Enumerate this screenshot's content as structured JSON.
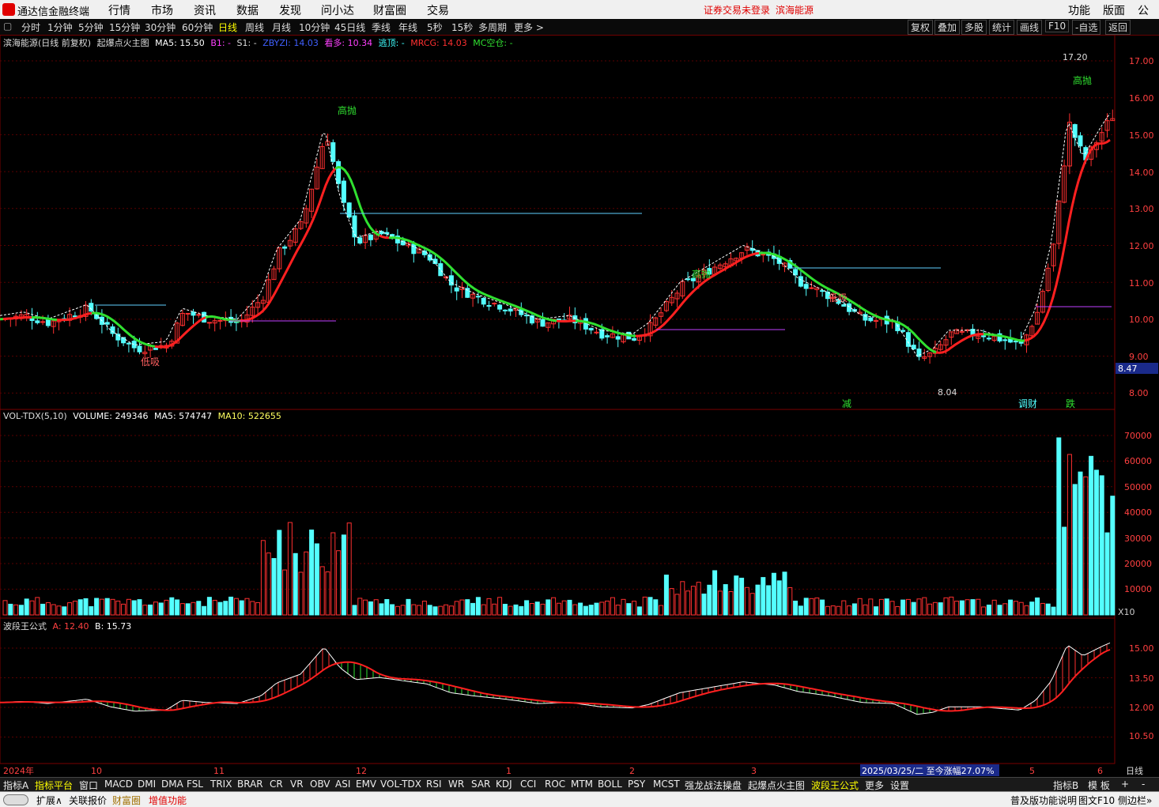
{
  "app": {
    "title": "通达信金融终端",
    "menu": [
      "行情",
      "市场",
      "资讯",
      "数据",
      "发现",
      "问小达",
      "财富圈",
      "交易"
    ],
    "status_login": "证券交易未登录",
    "status_stock": "滨海能源",
    "right_menu": [
      "功能",
      "版面",
      "公式"
    ]
  },
  "periods": {
    "items": [
      "分时",
      "1分钟",
      "5分钟",
      "15分钟",
      "30分钟",
      "60分钟",
      "日线",
      "周线",
      "月线",
      "10分钟",
      "45日线",
      "季线",
      "年线",
      "5秒",
      "15秒",
      "多周期",
      "更多 >"
    ],
    "active": "日线",
    "right_buttons": [
      "复权",
      "叠加",
      "多股",
      "统计",
      "画线",
      "F10",
      "-自选",
      "返回"
    ]
  },
  "main_panel": {
    "title": "滨海能源(日线 前复权)",
    "indicator": "起爆点火主图",
    "ma5": "MA5: 15.50",
    "b1": "B1: -",
    "s1": "S1: -",
    "zbyzi": "ZBYZI: 14.03",
    "kanduo": "看多: 10.34",
    "taoding": "逃顶: -",
    "mrcg": "MRCG: 14.03",
    "mckongcang": "MC空仓: -",
    "y_ticks": [
      "17.00",
      "16.00",
      "15.00",
      "14.00",
      "13.00",
      "12.00",
      "11.00",
      "10.00",
      "9.00",
      "8.00"
    ],
    "price_tag": "8.47",
    "high_label": "17.20",
    "low_label": "8.04",
    "annotations": {
      "gaopao": "高抛",
      "dixi": "低吸",
      "jian": "减",
      "tongcai": "调财",
      "die": "跌"
    }
  },
  "volume_panel": {
    "title": "VOL-TDX(5,10)",
    "volume": "VOLUME: 249346",
    "ma5": "MA5: 574747",
    "ma10": "MA10: 522655",
    "y_ticks": [
      "70000",
      "60000",
      "50000",
      "40000",
      "30000",
      "20000",
      "10000"
    ],
    "unit": "X10"
  },
  "wave_panel": {
    "title": "波段王公式",
    "a": "A: 12.40",
    "b": "B: 15.73",
    "y_ticks": [
      "15.00",
      "13.50",
      "12.00",
      "10.50"
    ]
  },
  "x_axis": {
    "labels": [
      "2024年",
      "10",
      "11",
      "12",
      "1",
      "2",
      "3",
      "5",
      "6"
    ],
    "info": "2025/03/25/二  至今涨幅27.07%",
    "period": "日线"
  },
  "indicator_tabs": [
    "指标A",
    "指标平台",
    "窗口",
    "MACD",
    "DMI",
    "DMA",
    "FSL",
    "TRIX",
    "BRAR",
    "CR",
    "VR",
    "OBV",
    "ASI",
    "EMV",
    "VOL-TDX",
    "RSI",
    "WR",
    "SAR",
    "KDJ",
    "CCI",
    "ROC",
    "MTM",
    "BOLL",
    "PSY",
    "MCST",
    "强龙战法操盘",
    "起爆点火主图",
    "波段王公式",
    "更多",
    "设置"
  ],
  "indicator_tabs_right": [
    "指标B",
    "模 板",
    "+",
    "-"
  ],
  "status_bar": {
    "items": [
      "扩展∧",
      "关联报价",
      "财富圈",
      "增值功能"
    ],
    "right": [
      "普及版功能说明",
      "图文F10",
      "侧边栏»"
    ]
  },
  "colors": {
    "up": "#ff3030",
    "down": "#54ffff",
    "grid": "#5a0000",
    "ma_green": "#30e030",
    "ma_red": "#ff2020"
  }
}
